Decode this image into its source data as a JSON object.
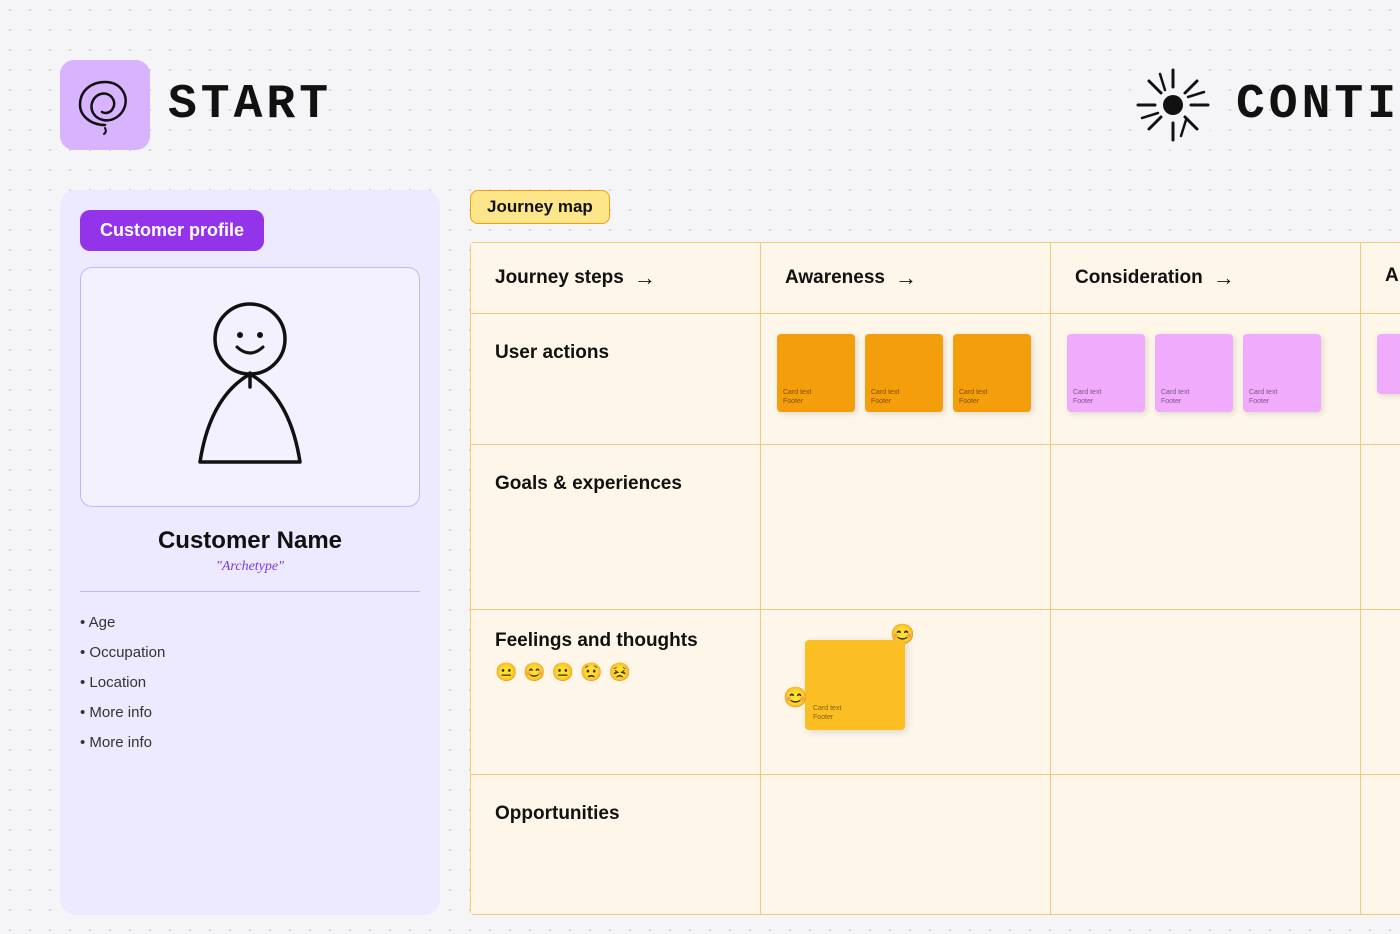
{
  "header": {
    "start_label": "START",
    "continue_label": "CONTI",
    "start_icon": "spiral-icon",
    "continue_icon": "sunburst-icon"
  },
  "customer_profile": {
    "header_label": "Customer profile",
    "name": "Customer Name",
    "archetype": "\"Archetype\"",
    "info_items": [
      "Age",
      "Occupation",
      "Location",
      "More info",
      "More info"
    ]
  },
  "journey_map": {
    "header_label": "Journey map",
    "columns": [
      {
        "id": "steps",
        "label": "Journey steps",
        "show_arrow": true
      },
      {
        "id": "awareness",
        "label": "Awareness",
        "show_arrow": true
      },
      {
        "id": "consideration",
        "label": "Consideration",
        "show_arrow": true
      },
      {
        "id": "next",
        "label": "A",
        "show_arrow": false
      }
    ],
    "rows": [
      {
        "id": "user-actions",
        "label": "User actions",
        "awareness_notes": [
          {
            "color": "orange",
            "text": "Card text",
            "footer": "Footer"
          },
          {
            "color": "orange",
            "text": "Card text",
            "footer": "Footer"
          },
          {
            "color": "orange",
            "text": "Card text",
            "footer": "Footer"
          }
        ],
        "consideration_notes": [
          {
            "color": "pink",
            "text": "Card text",
            "footer": "Footer"
          },
          {
            "color": "pink",
            "text": "Card text",
            "footer": "Footer"
          },
          {
            "color": "pink",
            "text": "Card text",
            "footer": "Footer"
          }
        ],
        "next_notes": [
          {
            "color": "pink",
            "text": "",
            "footer": ""
          }
        ]
      },
      {
        "id": "goals",
        "label": "Goals & experiences",
        "awareness_notes": [],
        "consideration_notes": [],
        "next_notes": []
      },
      {
        "id": "feelings",
        "label": "Feelings and thoughts",
        "emojis": [
          "😐",
          "😊",
          "😐",
          "😟",
          "😣"
        ],
        "awareness_large_note": {
          "color": "orange",
          "text": "Card text",
          "footer": "Footer",
          "emoji_top": "😊",
          "emoji_side": "😊"
        },
        "consideration_notes": [],
        "next_notes": []
      },
      {
        "id": "opportunities",
        "label": "Opportunities",
        "awareness_notes": [],
        "consideration_notes": [],
        "next_notes": []
      }
    ]
  }
}
